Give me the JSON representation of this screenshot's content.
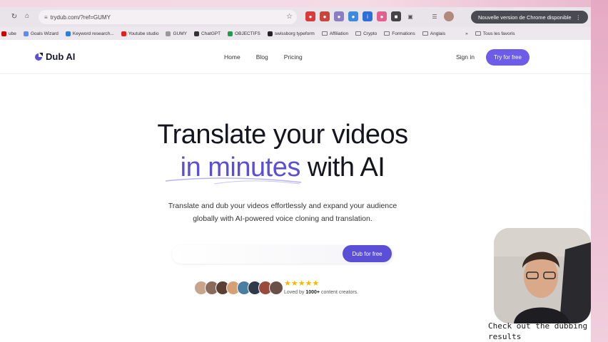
{
  "browser": {
    "url": "trydub.com/?ref=GUMY",
    "chrome_notice": "Nouvelle version de Chrome disponible",
    "bookmarks": [
      {
        "label": "ube",
        "color": "#cc0000"
      },
      {
        "label": "Goals Wizard",
        "color": "#5b8def"
      },
      {
        "label": "Keyword research...",
        "color": "#2a7de1"
      },
      {
        "label": "Youtube studio",
        "color": "#e62117"
      },
      {
        "label": "GUMY",
        "color": "#999999"
      },
      {
        "label": "ChatGPT",
        "color": "#333333"
      },
      {
        "label": "OBJECTIFS",
        "color": "#1e9e4a"
      },
      {
        "label": "swissborg typeform",
        "color": "#222222"
      },
      {
        "label": "Affiliation",
        "folder": true
      },
      {
        "label": "Crypto",
        "folder": true
      },
      {
        "label": "Formations",
        "folder": true
      },
      {
        "label": "Anglais",
        "folder": true
      },
      {
        "label": "Tous les favoris",
        "folder": true
      }
    ],
    "chevron": "»"
  },
  "site": {
    "logo_text": "Dub AI",
    "nav": {
      "home": "Home",
      "blog": "Blog",
      "pricing": "Pricing"
    },
    "sign_in": "Sign in",
    "try_free": "Try for free",
    "colors": {
      "accent": "#5b4fd8",
      "button": "#6c5ce7",
      "stars": "#f5b800"
    }
  },
  "hero": {
    "title_line1": "Translate your videos",
    "title_accent": "in minutes",
    "title_rest": " with AI",
    "subtitle_line1": "Translate and dub your videos effortlessly and expand your audience",
    "subtitle_line2": "globally with AI-powered voice cloning and translation.",
    "input_placeholder": "",
    "cta": "Dub for free",
    "stars": "★★★★★",
    "loved_prefix": "Loved by ",
    "loved_count": "1000+",
    "loved_suffix": " content creators."
  },
  "overlay": {
    "caption": "Check out the dubbing results"
  }
}
